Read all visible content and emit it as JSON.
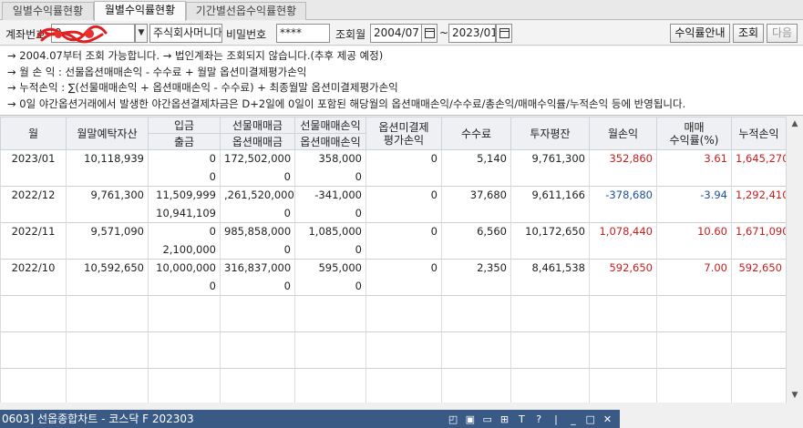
{
  "tabs": [
    {
      "label": "일별수익률현황",
      "active": false
    },
    {
      "label": "월별수익률현황",
      "active": true
    },
    {
      "label": "기간별선옵수익률현황",
      "active": false
    }
  ],
  "toolbar": {
    "account_label": "계좌번호",
    "account_value": "              9",
    "account_name": "주식회사머니대",
    "password_label": "비밀번호",
    "password_value": "****",
    "period_label": "조회월",
    "from_month": "2004/07",
    "tilde": "~",
    "to_month": "2023/01",
    "guide_button": "수익률안내",
    "query_button": "조회",
    "next_button": "다음"
  },
  "info_lines": [
    "→ 2004.07부터 조회 가능합니다. → 법인계좌는 조회되지 않습니다.(추후 제공 예정)",
    "→ 월 손 익 : 선물옵션매매손익 - 수수료 + 월말 옵션미결제평가손익",
    "→ 누적손익 : ∑(선물매매손익 + 옵션매매손익 - 수수료) + 최종월말 옵션미결제평가손익",
    "→ 0일 야간옵션거래에서 발생한 야간옵션결제차금은 D+2일에 0일이 포함된 해당월의 옵션매매손익/수수료/총손익/매매수익률/누적손익 등에 반영됩니다."
  ],
  "columns": {
    "month": "월",
    "assets": "월말예탁자산",
    "deposit": "입금",
    "withdraw": "출금",
    "fut_amt": "선물매매금",
    "opt_amt": "옵션매매금",
    "fut_pl": "선물매매손익",
    "opt_pl": "옵션매매손익",
    "unsettled_1": "옵션미결제",
    "unsettled_2": "평가손익",
    "fee": "수수료",
    "invest": "투자평잔",
    "month_pl": "월손익",
    "ret_1": "매매",
    "ret_2": "수익률(%)",
    "cum_pl": "누적손익"
  },
  "rows": [
    {
      "month": "2023/01",
      "assets": "10,118,939",
      "deposit": "0",
      "withdraw": "0",
      "fut_amt": "172,502,000",
      "opt_amt": "0",
      "fut_pl": "358,000",
      "opt_pl": "0",
      "unsettled": "0",
      "fee": "5,140",
      "invest": "9,761,300",
      "month_pl": "352,860",
      "ret": "3.61",
      "cum_pl": "1,645,270",
      "sign": "pos"
    },
    {
      "month": "2022/12",
      "assets": "9,761,300",
      "deposit": "11,509,999",
      "withdraw": "10,941,109",
      "fut_amt": ",261,520,000",
      "opt_amt": "0",
      "fut_pl": "-341,000",
      "opt_pl": "0",
      "unsettled": "0",
      "fee": "37,680",
      "invest": "9,611,166",
      "month_pl": "-378,680",
      "ret": "-3.94",
      "cum_pl": "1,292,410",
      "sign": "neg"
    },
    {
      "month": "2022/11",
      "assets": "9,571,090",
      "deposit": "0",
      "withdraw": "2,100,000",
      "fut_amt": "985,858,000",
      "opt_amt": "0",
      "fut_pl": "1,085,000",
      "opt_pl": "0",
      "unsettled": "0",
      "fee": "6,560",
      "invest": "10,172,650",
      "month_pl": "1,078,440",
      "ret": "10.60",
      "cum_pl": "1,671,090",
      "sign": "pos"
    },
    {
      "month": "2022/10",
      "assets": "10,592,650",
      "deposit": "10,000,000",
      "withdraw": "0",
      "fut_amt": "316,837,000",
      "opt_amt": "0",
      "fut_pl": "595,000",
      "opt_pl": "0",
      "unsettled": "0",
      "fee": "2,350",
      "invest": "8,461,538",
      "month_pl": "592,650",
      "ret": "7.00",
      "cum_pl": "592,650",
      "sign": "pos"
    }
  ],
  "bottom_bar": {
    "text": "0603] 선옵종합차트 - 코스닥 F 202303"
  },
  "colors": {
    "positive": "#c81e1e",
    "negative": "#1f4e9a",
    "header_bg": "#eef0f3",
    "bottom_bar": "#3a5a86"
  }
}
